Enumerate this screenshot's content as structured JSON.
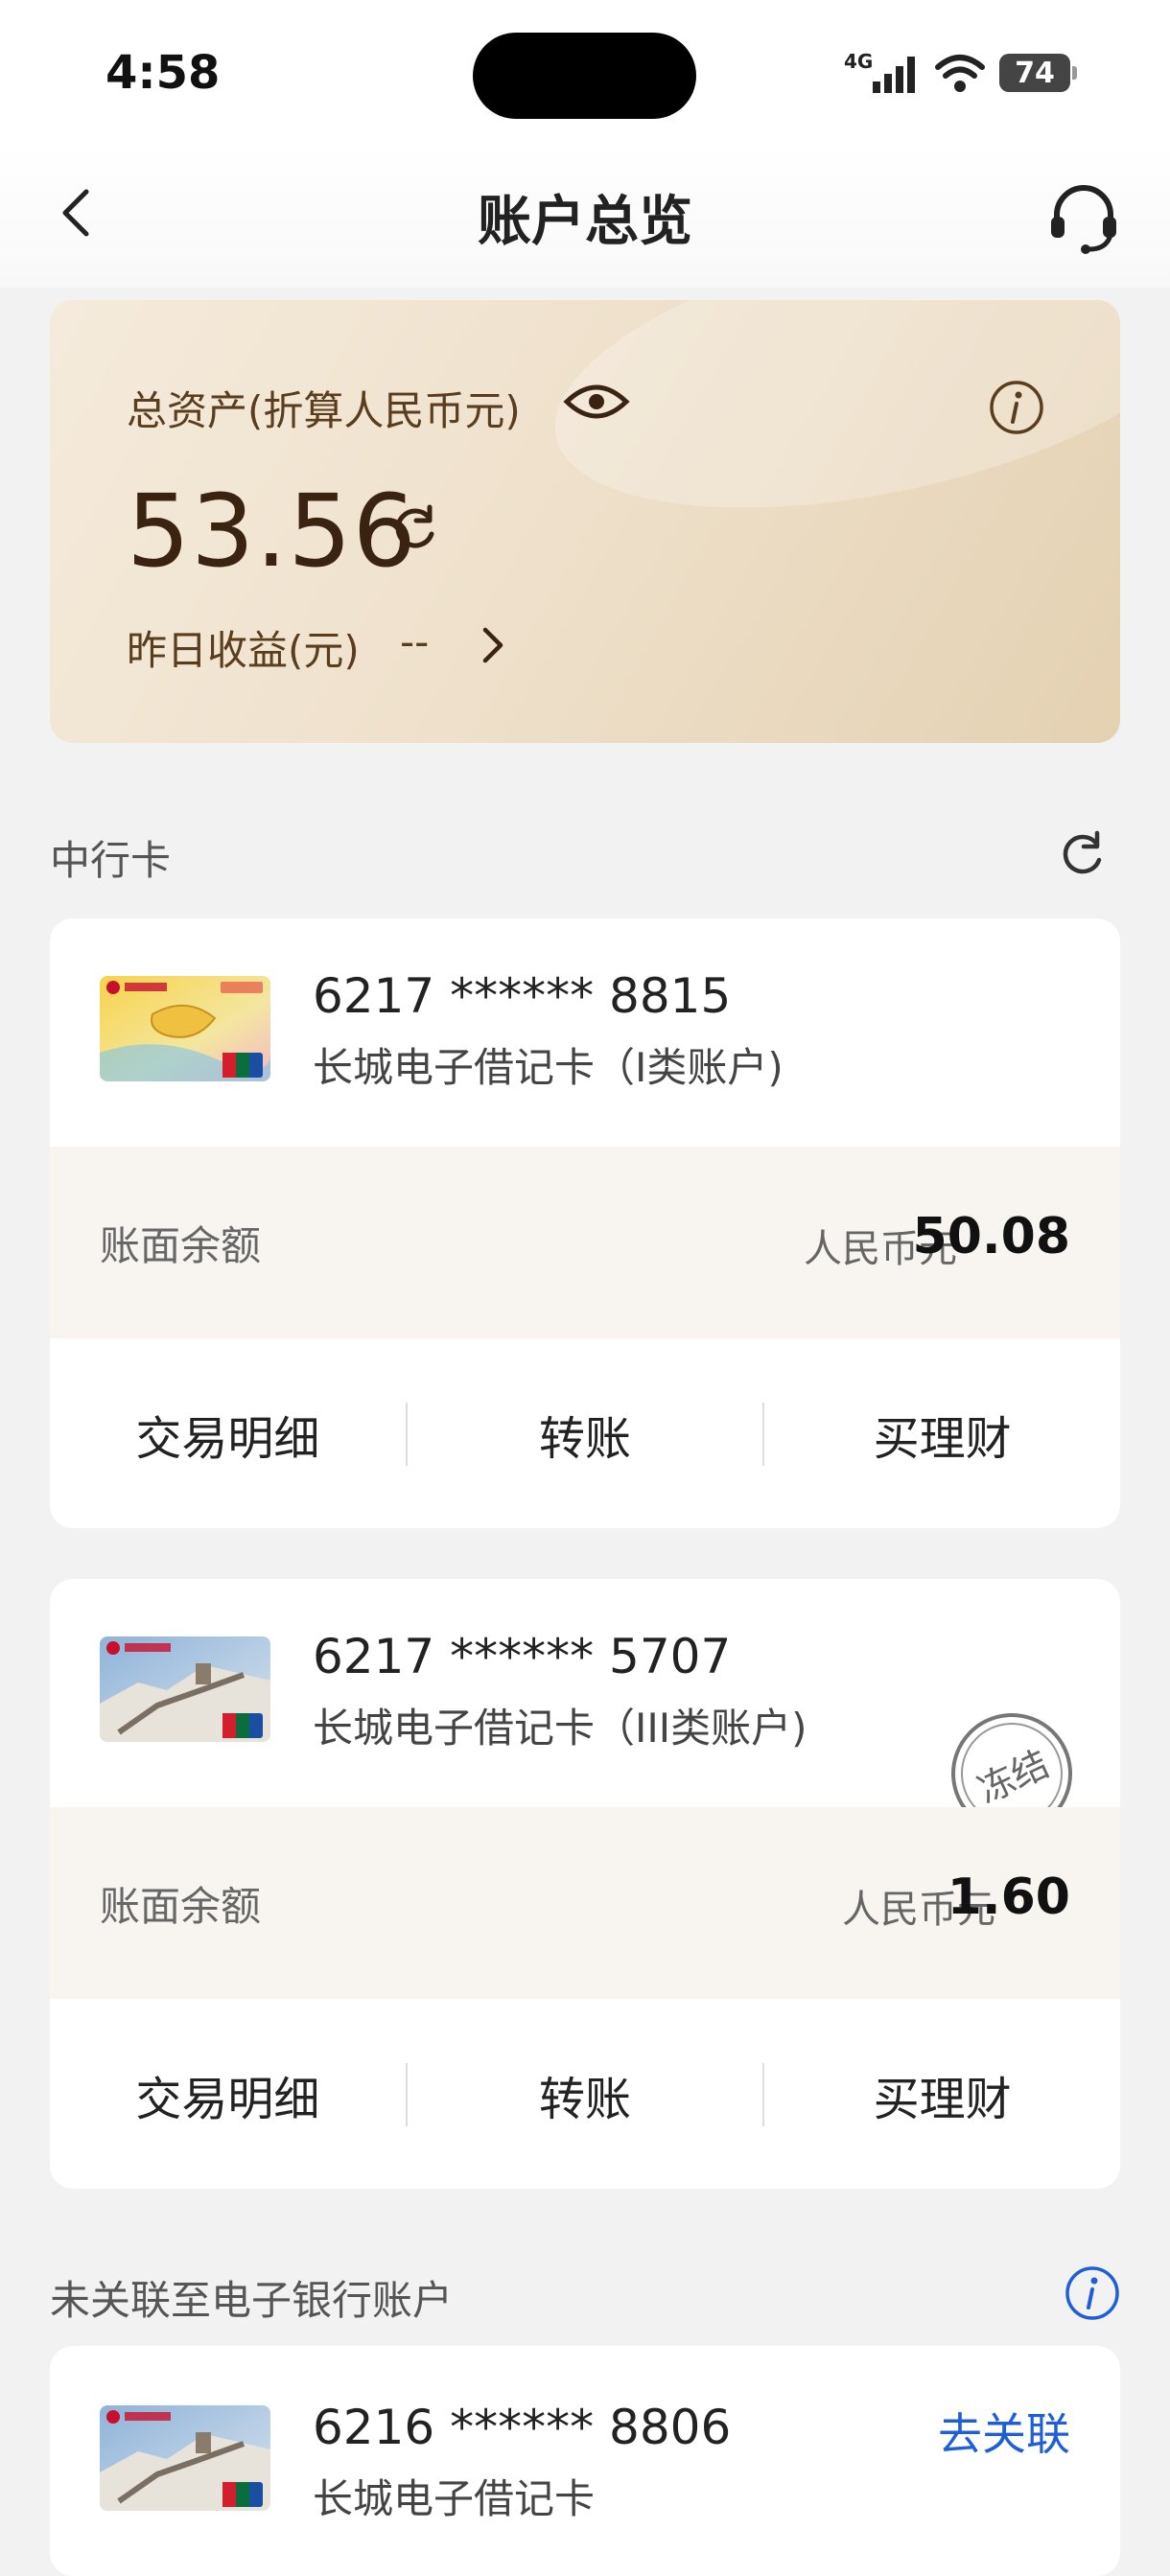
{
  "status": {
    "time": "4:58",
    "network": "4G",
    "battery": "74"
  },
  "header": {
    "title": "账户总览"
  },
  "asset": {
    "label": "总资产(折算人民币元)",
    "value": "53.56",
    "yesterday_label": "昨日收益(元)",
    "yesterday_value": "--"
  },
  "section_boc": {
    "title": "中行卡"
  },
  "cards": [
    {
      "number": "6217 ****** 8815",
      "type": "长城电子借记卡（I类账户)",
      "balance_label": "账面余额",
      "currency": "人民币元",
      "amount": "50.08",
      "actions": [
        "交易明细",
        "转账",
        "买理财"
      ]
    },
    {
      "number": "6217 ****** 5707",
      "type": "长城电子借记卡（III类账户)",
      "balance_label": "账面余额",
      "currency": "人民币元",
      "amount": "1.60",
      "frozen_label": "冻结",
      "actions": [
        "交易明细",
        "转账",
        "买理财"
      ]
    }
  ],
  "section_unlinked": {
    "title": "未关联至电子银行账户"
  },
  "unlinked_card": {
    "number": "6216 ****** 8806",
    "type": "长城电子借记卡",
    "link_label": "去关联"
  },
  "colors": {
    "accent_blue": "#1e5ed6",
    "gold_text": "#5a3d1e",
    "balance_bg": "#f8f4f0"
  }
}
